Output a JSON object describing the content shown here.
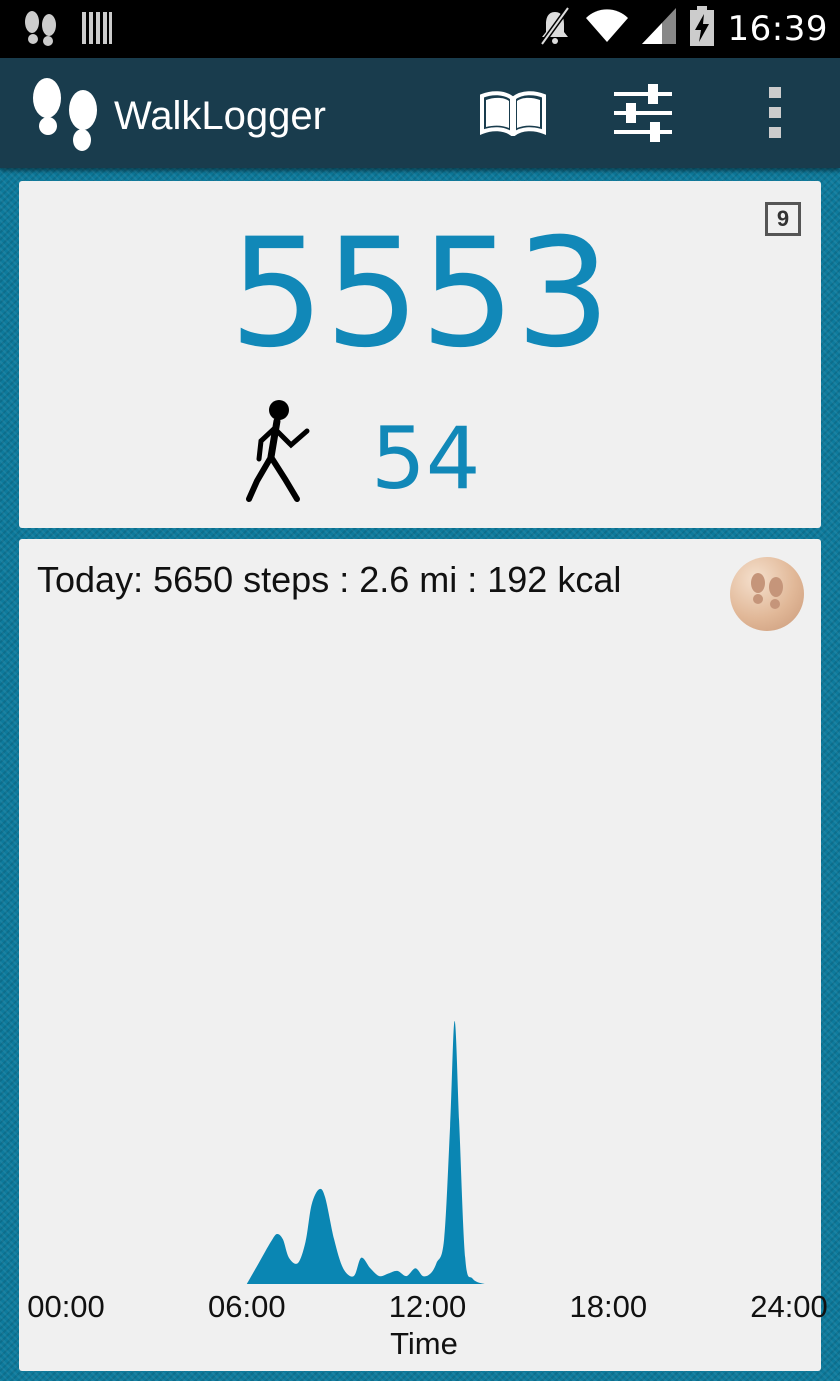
{
  "status_bar": {
    "time": "16:39",
    "icons": [
      "footprints-icon",
      "barcode-icon",
      "mute-icon",
      "wifi-icon",
      "signal-icon",
      "battery-charging-icon"
    ]
  },
  "app_bar": {
    "title": "WalkLogger",
    "icons": [
      "footprints-logo-icon",
      "book-icon",
      "sliders-icon",
      "overflow-menu-icon"
    ]
  },
  "counter": {
    "steps": "5553",
    "badge": "9",
    "cadence": "54",
    "walker_icon": "walker-icon"
  },
  "daily": {
    "summary": "Today: 5650 steps : 2.6 mi : 192 kcal",
    "coin_icon": "footprints-coin-icon"
  },
  "chart_data": {
    "type": "area",
    "xlabel": "Time",
    "ylabel": "",
    "x_ticks": [
      "00:00",
      "06:00",
      "12:00",
      "18:00",
      "24:00"
    ],
    "xlim": [
      0,
      24
    ],
    "x": [
      6.0,
      6.4,
      6.8,
      7.0,
      7.2,
      7.4,
      7.7,
      7.95,
      8.15,
      8.4,
      8.6,
      8.9,
      9.2,
      9.55,
      9.8,
      10.1,
      10.4,
      10.7,
      11.0,
      11.3,
      11.6,
      11.85,
      12.1,
      12.3,
      12.55,
      12.75,
      12.9,
      13.05,
      13.25,
      13.5,
      13.9
    ],
    "y": [
      0,
      8,
      16,
      19,
      17,
      10,
      8,
      16,
      30,
      36,
      33,
      17,
      6,
      3,
      10,
      6,
      3,
      4,
      5,
      3,
      6,
      3,
      4,
      8,
      17,
      60,
      100,
      62,
      10,
      2,
      0
    ],
    "color": "#0a86b3",
    "grid": false
  }
}
